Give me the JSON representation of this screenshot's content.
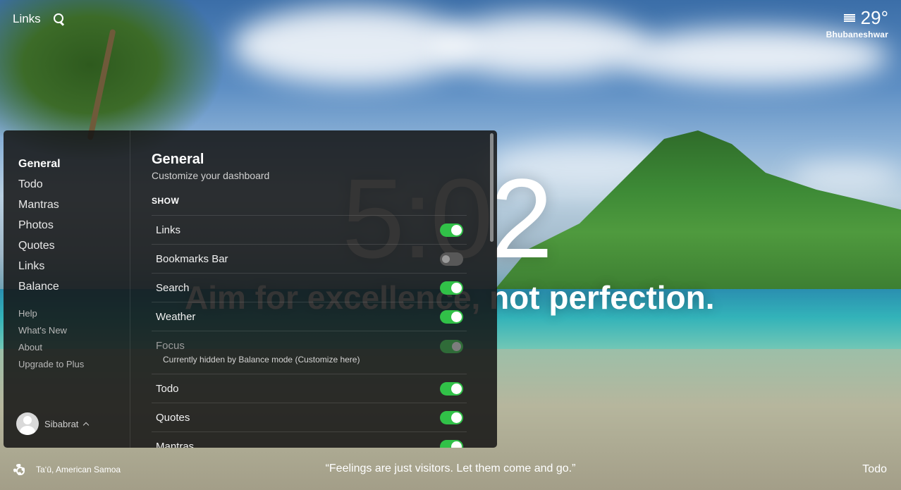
{
  "background": {
    "clock_time": "5:02",
    "mantra": "Aim for excellence, not perfection."
  },
  "top_bar": {
    "links_label": "Links",
    "search_icon": "search-icon"
  },
  "weather": {
    "icon": "fog-icon",
    "temperature": "29°",
    "city": "Bhubaneshwar"
  },
  "settings": {
    "nav": {
      "main_items": [
        "General",
        "Todo",
        "Mantras",
        "Photos",
        "Quotes",
        "Links",
        "Balance"
      ],
      "active": "General",
      "secondary_items": [
        "Help",
        "What's New",
        "About",
        "Upgrade to Plus"
      ]
    },
    "user": {
      "name": "Sibabrat"
    },
    "general": {
      "title": "General",
      "subtitle": "Customize your dashboard",
      "section_label": "SHOW",
      "rows": [
        {
          "label": "Links",
          "enabled": true
        },
        {
          "label": "Bookmarks Bar",
          "enabled": false
        },
        {
          "label": "Search",
          "enabled": true
        },
        {
          "label": "Weather",
          "enabled": true
        },
        {
          "label": "Focus",
          "enabled": true,
          "disabled": true,
          "note": "Currently hidden by Balance mode (Customize here)"
        },
        {
          "label": "Todo",
          "enabled": true
        },
        {
          "label": "Quotes",
          "enabled": true
        },
        {
          "label": "Mantras",
          "enabled": true
        }
      ]
    }
  },
  "bottom_bar": {
    "location": "Ta‘ū, American Samoa",
    "quote": "“Feelings are just visitors. Let them come and go.”",
    "todo_label": "Todo"
  },
  "colors": {
    "toggle_on": "#31c148",
    "toggle_off": "#585858",
    "panel_bg": "#141414"
  }
}
